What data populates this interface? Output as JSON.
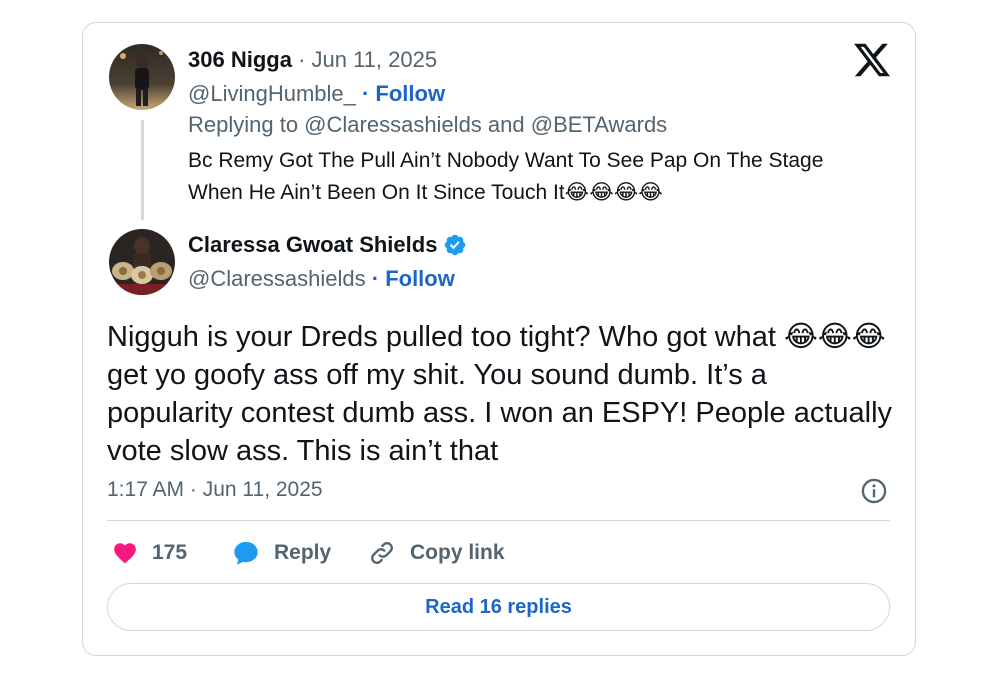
{
  "reply_tweet": {
    "author_name": "306 Nigga",
    "date": "· Jun 11, 2025",
    "handle": "@LivingHumble_",
    "follow_label": "· Follow",
    "replying_to": "Replying to @Claressashields and @BETAwards",
    "text_line1": "Bc Remy Got The Pull Ain’t Nobody Want To See Pap On The Stage",
    "text_line2": "When He Ain’t Been On It Since Touch It",
    "text_emojis": "😂😂😂😂"
  },
  "main_tweet": {
    "author_name": "Claressa Gwoat Shields",
    "handle": "@Claressashields",
    "follow_label": "· Follow",
    "text": "Nigguh is your Dreds pulled too tight? Who got what 😂😂😂 get yo goofy ass off my shit. You sound dumb. It’s a popularity contest dumb ass. I won an ESPY! People actually vote slow ass. This is ain’t that",
    "timestamp": "1:17 AM · Jun 11, 2025"
  },
  "actions": {
    "like_count": "175",
    "reply_label": "Reply",
    "copy_link_label": "Copy link"
  },
  "read_replies_label": "Read 16 replies",
  "icons": {
    "logo": "x-logo-icon",
    "verified": "verified-badge-icon",
    "info": "info-icon",
    "like": "heart-icon",
    "reply": "speech-bubble-icon",
    "copy_link": "link-icon"
  },
  "colors": {
    "accent": "#1d66c8",
    "verified": "#1d9bf0",
    "heart": "#f91880",
    "muted": "#536471",
    "border": "#cfd9de"
  }
}
